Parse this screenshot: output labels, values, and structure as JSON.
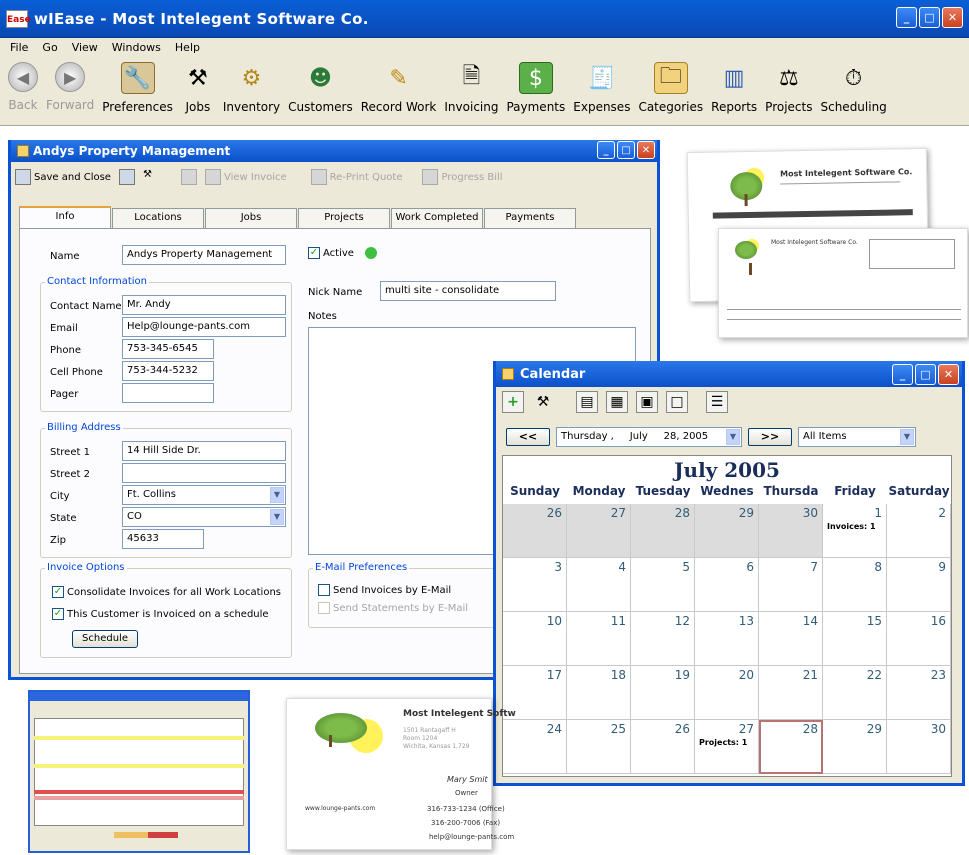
{
  "app": {
    "title": "wIEase - Most Intelegent Software Co.",
    "logo_text": "Ease"
  },
  "menu": [
    "File",
    "Go",
    "View",
    "Windows",
    "Help"
  ],
  "toolbar": [
    {
      "label": "Back",
      "icon": "back-arrow-icon",
      "disabled": true
    },
    {
      "label": "Forward",
      "icon": "forward-arrow-icon",
      "disabled": true
    },
    {
      "label": "Preferences",
      "icon": "preferences-icon"
    },
    {
      "label": "Jobs",
      "icon": "tools-icon"
    },
    {
      "label": "Inventory",
      "icon": "gears-icon"
    },
    {
      "label": "Customers",
      "icon": "person-icon"
    },
    {
      "label": "Record Work",
      "icon": "pencil-icon"
    },
    {
      "label": "Invoicing",
      "icon": "invoice-icon"
    },
    {
      "label": "Payments",
      "icon": "money-icon"
    },
    {
      "label": "Expenses",
      "icon": "receipt-icon"
    },
    {
      "label": "Categories",
      "icon": "folders-icon"
    },
    {
      "label": "Reports",
      "icon": "bar-chart-icon"
    },
    {
      "label": "Projects",
      "icon": "compass-icon"
    },
    {
      "label": "Scheduling",
      "icon": "clock-icon"
    }
  ],
  "customer": {
    "window_title": "Andys Property Management",
    "toolbar": {
      "save_close": "Save and Close",
      "view_invoice": "View Invoice",
      "reprint_quote": "Re-Print Quote",
      "progress_bill": "Progress Bill"
    },
    "tabs": [
      "Info",
      "Locations",
      "Jobs",
      "Projects",
      "Work Completed",
      "Payments"
    ],
    "name_label": "Name",
    "name": "Andys Property Management",
    "active_label": "Active",
    "nick_label": "Nick Name",
    "nick_name": "multi site - consolidate",
    "notes_label": "Notes",
    "contact": {
      "title": "Contact Information",
      "contact_name_label": "Contact Name",
      "contact_name": "Mr. Andy",
      "email_label": "Email",
      "email": "Help@lounge-pants.com",
      "phone_label": "Phone",
      "phone": "753-345-6545",
      "cell_label": "Cell Phone",
      "cell": "753-344-5232",
      "pager_label": "Pager",
      "pager": ""
    },
    "billing": {
      "title": "Billing Address",
      "street1_label": "Street 1",
      "street1": "14 Hill Side Dr.",
      "street2_label": "Street 2",
      "street2": "",
      "city_label": "City",
      "city": "Ft. Collins",
      "state_label": "State",
      "state": "CO",
      "zip_label": "Zip",
      "zip": "45633"
    },
    "invoice_options": {
      "title": "Invoice Options",
      "consolidate": "Consolidate Invoices for all Work Locations",
      "schedule": "This Customer is Invoiced on a schedule",
      "schedule_button": "Schedule"
    },
    "email_prefs": {
      "title": "E-Mail Preferences",
      "send_invoices": "Send Invoices by E-Mail",
      "send_statements": "Send Statements by E-Mail"
    }
  },
  "calendar": {
    "window_title": "Calendar",
    "prev": "<<",
    "next": ">>",
    "date_select": "Thursday ,     July     28, 2005",
    "filter_select": "All Items",
    "month_title": "July 2005",
    "weekdays": [
      "Sunday",
      "Monday",
      "Tuesday",
      "Wednes",
      "Thursda",
      "Friday",
      "Saturday"
    ],
    "weeks": [
      [
        {
          "d": "26",
          "o": true
        },
        {
          "d": "27",
          "o": true
        },
        {
          "d": "28",
          "o": true
        },
        {
          "d": "29",
          "o": true
        },
        {
          "d": "30",
          "o": true
        },
        {
          "d": "1",
          "n": "Invoices: 1"
        },
        {
          "d": "2"
        }
      ],
      [
        {
          "d": "3"
        },
        {
          "d": "4"
        },
        {
          "d": "5"
        },
        {
          "d": "6"
        },
        {
          "d": "7"
        },
        {
          "d": "8"
        },
        {
          "d": "9"
        }
      ],
      [
        {
          "d": "10"
        },
        {
          "d": "11"
        },
        {
          "d": "12"
        },
        {
          "d": "13"
        },
        {
          "d": "14"
        },
        {
          "d": "15"
        },
        {
          "d": "16"
        }
      ],
      [
        {
          "d": "17"
        },
        {
          "d": "18"
        },
        {
          "d": "19"
        },
        {
          "d": "20"
        },
        {
          "d": "21"
        },
        {
          "d": "22"
        },
        {
          "d": "23"
        }
      ],
      [
        {
          "d": "24"
        },
        {
          "d": "25"
        },
        {
          "d": "26"
        },
        {
          "d": "27",
          "n": "Projects: 1"
        },
        {
          "d": "28",
          "s": true
        },
        {
          "d": "29"
        },
        {
          "d": "30"
        }
      ]
    ]
  },
  "invoice_doc": {
    "company": "Most Intelegent Software Co."
  },
  "business_card": {
    "company": "Most Intelegent Softw",
    "address1": "1501 Rantagaff H",
    "address2": "Room 1204",
    "address3": "Wichita, Kansas 1,729",
    "person": "Mary Smit",
    "role": "Owner",
    "phone_office": "316-733-1234 (Office)",
    "phone_fax": "316-200-7006 (Fax)",
    "email": "help@lounge-pants.com",
    "website": "www.lounge-pants.com"
  },
  "colors": {
    "title_blue": "#0948b3",
    "xp_face": "#ece9d8",
    "accent_orange": "#e8a33d",
    "active_green": "#21a121"
  }
}
